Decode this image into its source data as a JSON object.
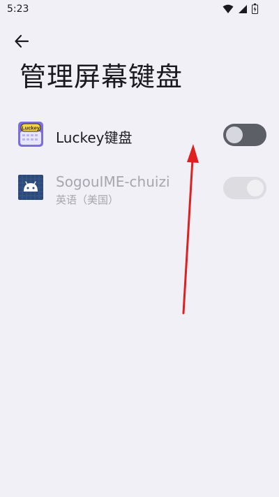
{
  "status_bar": {
    "time": "5:23",
    "icons": [
      "wifi-icon",
      "signal-icon",
      "battery-icon"
    ]
  },
  "page": {
    "title": "管理屏幕键盘"
  },
  "keyboards": [
    {
      "name": "Luckey键盘",
      "subtitle": "",
      "icon": "luckey-app-icon",
      "icon_text": "Luckey",
      "enabled": false,
      "disabled": false
    },
    {
      "name": "SogouIME-chuizi",
      "subtitle": "英语（美国）",
      "icon": "android-app-icon",
      "enabled": true,
      "disabled": true
    }
  ],
  "colors": {
    "background": "#f1f0f6",
    "annotation_arrow": "#e02020",
    "toggle_off_track": "#5c5f66",
    "toggle_disabled_track": "#dcdce1"
  }
}
